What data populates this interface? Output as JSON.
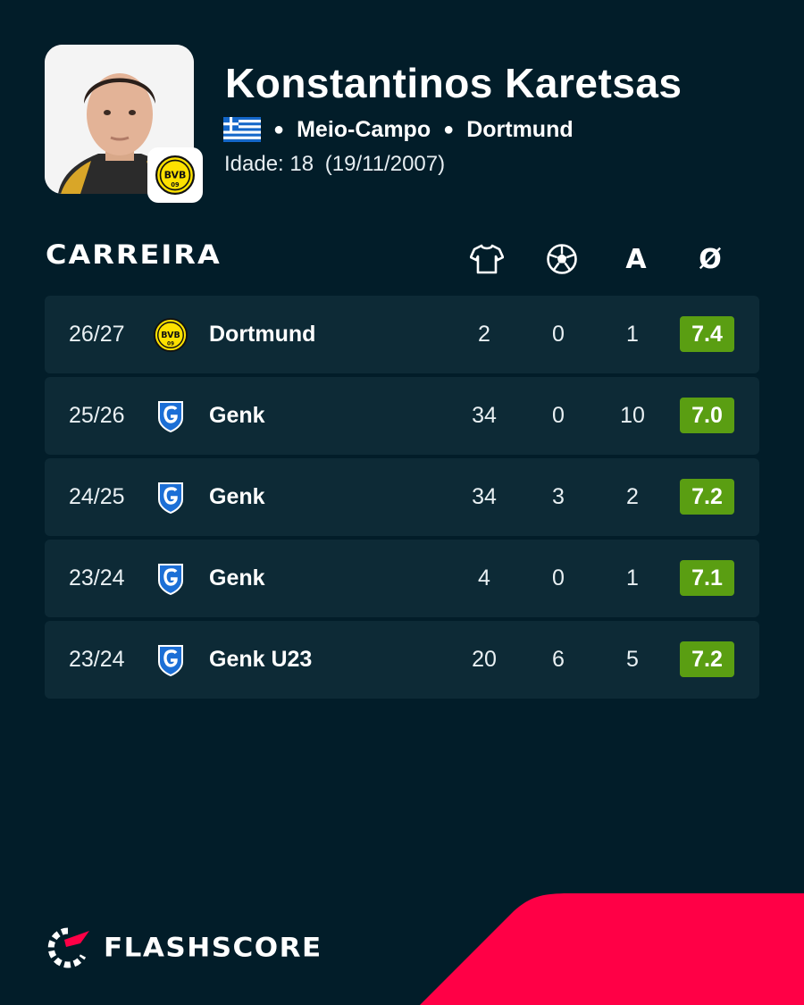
{
  "player": {
    "name": "Konstantinos Karetsas",
    "flag": "greece-flag-icon",
    "position": "Meio-Campo",
    "club": "Dortmund",
    "age_label": "Idade:",
    "age": "18",
    "birth_date": "(19/11/2007)"
  },
  "career": {
    "title": "CARREIRA",
    "columns": [
      {
        "icon": "shirt-icon",
        "label": ""
      },
      {
        "icon": "ball-icon",
        "label": ""
      },
      {
        "icon": "",
        "label": "A"
      },
      {
        "icon": "",
        "label": "Ø"
      }
    ],
    "rows": [
      {
        "season": "26/27",
        "logo": "bvb-logo-icon",
        "club": "Dortmund",
        "apps": "2",
        "goals": "0",
        "assists": "1",
        "rating": "7.4"
      },
      {
        "season": "25/26",
        "logo": "genk-logo-icon",
        "club": "Genk",
        "apps": "34",
        "goals": "0",
        "assists": "10",
        "rating": "7.0"
      },
      {
        "season": "24/25",
        "logo": "genk-logo-icon",
        "club": "Genk",
        "apps": "34",
        "goals": "3",
        "assists": "2",
        "rating": "7.2"
      },
      {
        "season": "23/24",
        "logo": "genk-logo-icon",
        "club": "Genk",
        "apps": "4",
        "goals": "0",
        "assists": "1",
        "rating": "7.1"
      },
      {
        "season": "23/24",
        "logo": "genk-logo-icon",
        "club": "Genk U23",
        "apps": "20",
        "goals": "6",
        "assists": "5",
        "rating": "7.2"
      }
    ]
  },
  "brand": {
    "name": "FLASHSCORE"
  },
  "colors": {
    "background": "#021d29",
    "row_background": "#0d2a36",
    "rating_green": "#5a9e12",
    "accent_red": "#ff0046",
    "bvb_yellow": "#fde100",
    "genk_blue": "#1c6fd6"
  }
}
